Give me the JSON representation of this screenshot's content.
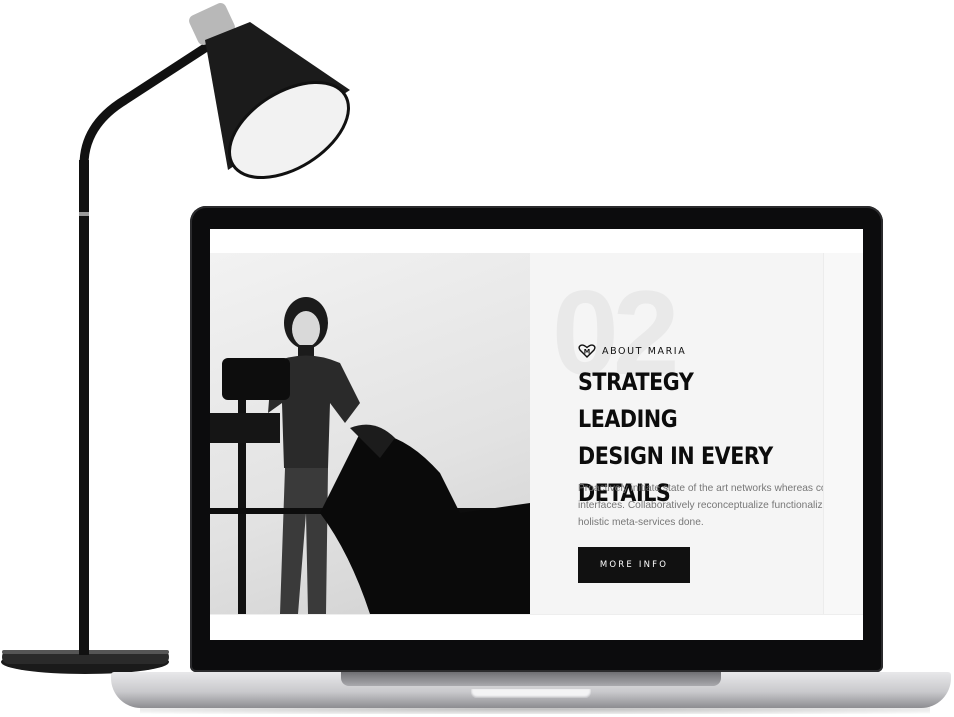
{
  "section": {
    "background_number": "02",
    "eyebrow": "ABOUT MARIA",
    "headline": "STRATEGY LEADING\nDESIGN IN EVERY\nDETAILS",
    "description": "Proactively initiate state of the art networks whereas cost interfaces. Collaboratively reconceptualize functionalized and holistic meta-services done.",
    "button_label": "MORE INFO"
  },
  "icons": {
    "logo": "heart-m-icon"
  },
  "colors": {
    "accent": "#111111",
    "text_muted": "#777777",
    "panel_bg": "#f5f5f5"
  }
}
